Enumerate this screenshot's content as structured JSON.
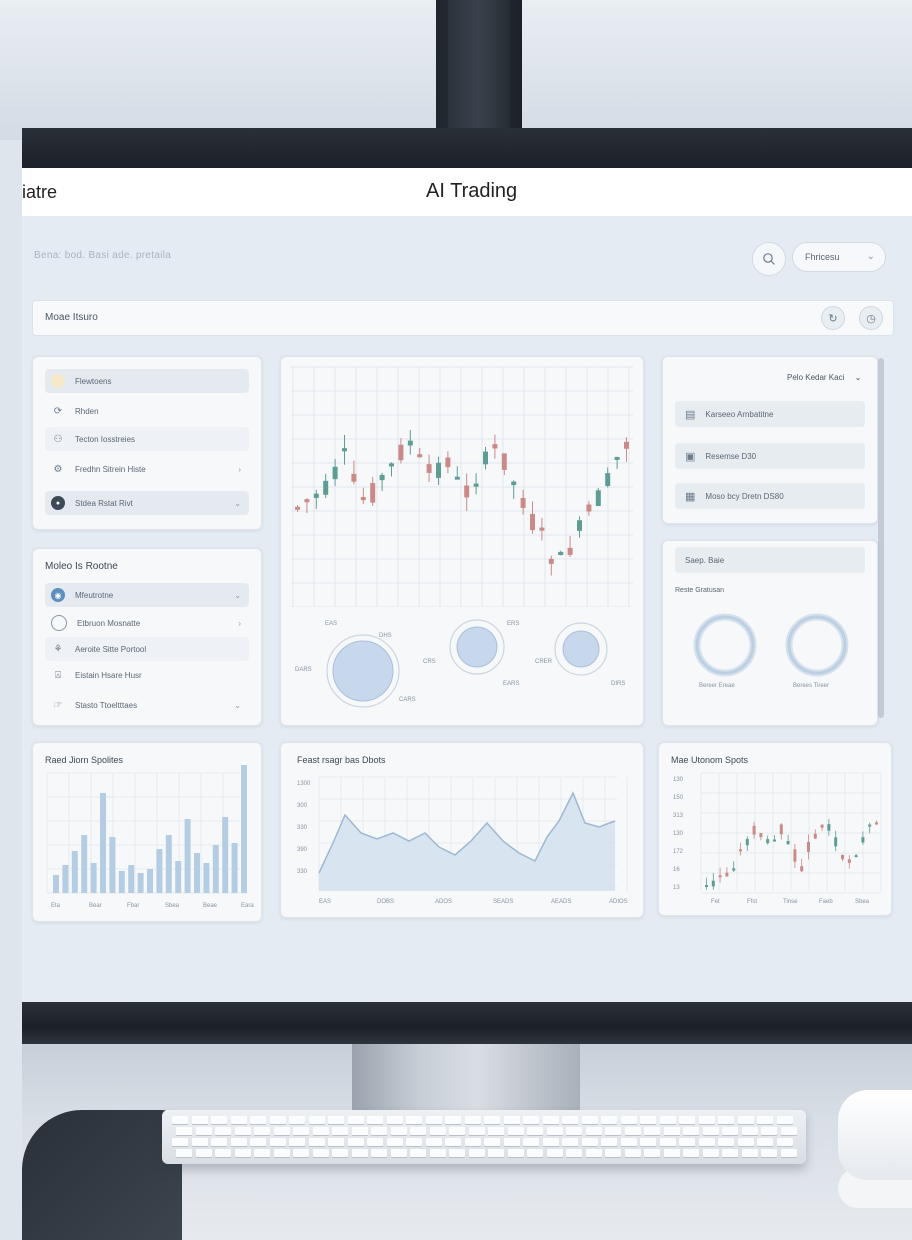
{
  "header": {
    "app_name": "iatre",
    "title": "AI Trading"
  },
  "toolbar": {
    "search_placeholder": "Bena: bod. Basi ade. pretaila",
    "profile_label": "Fhricesu"
  },
  "main_bar": {
    "label": "Moae Itsuro"
  },
  "left_panel_top": {
    "items": [
      {
        "label": "Flewtoens",
        "icon": "circle-icon"
      },
      {
        "label": "Rhden",
        "icon": "refresh-icon"
      },
      {
        "label": "Tecton Iosstreies",
        "icon": "user-icon"
      },
      {
        "label": "Fredhn Sitrein Histe",
        "icon": "grid-icon"
      },
      {
        "label": "Stdea Rstat Rivt",
        "icon": "record-icon"
      }
    ]
  },
  "left_panel_bottom": {
    "title": "Moleo Is Rootne",
    "items": [
      {
        "label": "Mfeutrotne",
        "icon": "globe-icon"
      },
      {
        "label": "Etbruon Mosnatte",
        "icon": "circle-icon"
      },
      {
        "label": "Aeroite Sitte Portool",
        "icon": "chart-icon"
      },
      {
        "label": "Eistain Hsare Husr",
        "icon": "lock-icon"
      },
      {
        "label": "Stasto Ttoeltttaes",
        "icon": "hand-icon"
      }
    ]
  },
  "center_panel": {
    "dial_labels": [
      "EAS",
      "DHS",
      "DARS",
      "CARS",
      "ERS",
      "CRS",
      "EARS",
      "CRER",
      "DIRS"
    ]
  },
  "right_panel_top": {
    "dropdown_label": "Pelo Kedar Kaci",
    "items": [
      {
        "label": "Karseeo Arnbatitne",
        "icon": "clipboard-icon"
      },
      {
        "label": "Resemse D30",
        "icon": "wallet-icon"
      },
      {
        "label": "Moso bcy Dretn DS80",
        "icon": "calendar-icon"
      }
    ]
  },
  "right_panel_bottom": {
    "header_label": "Saep. Baie",
    "subtitle": "Reste Gratusan",
    "ring_labels": [
      "Bereer Ereae",
      "Berees Tireer"
    ]
  },
  "bar_panel": {
    "title": "Raed Jiorn Spolites",
    "x_ticks": [
      "Eta",
      "Bear",
      "Fbar",
      "Sbea",
      "Beae",
      "Eara"
    ]
  },
  "area_panel": {
    "title": "Feast rsagr bas Dbots",
    "y_ticks": [
      "1300",
      "300",
      "330",
      "390",
      "330"
    ],
    "x_ticks": [
      "EAS",
      "DOBS",
      "ADOS",
      "SEADS",
      "AEADS",
      "ADIOS"
    ]
  },
  "candle_panel": {
    "title": "Mae Utonom Spots",
    "y_ticks": [
      "130",
      "150",
      "313",
      "130",
      "172",
      "16",
      "13"
    ],
    "x_ticks": [
      "Fet",
      "Ffst",
      "Tinse",
      "Faeb",
      "Sbea"
    ]
  },
  "colors": {
    "up_candle": "#5f9d94",
    "down_candle": "#c98a88",
    "bar_fill": "#b5cde3",
    "area_fill": "#d3e1ee",
    "area_line": "#9db8d2"
  }
}
